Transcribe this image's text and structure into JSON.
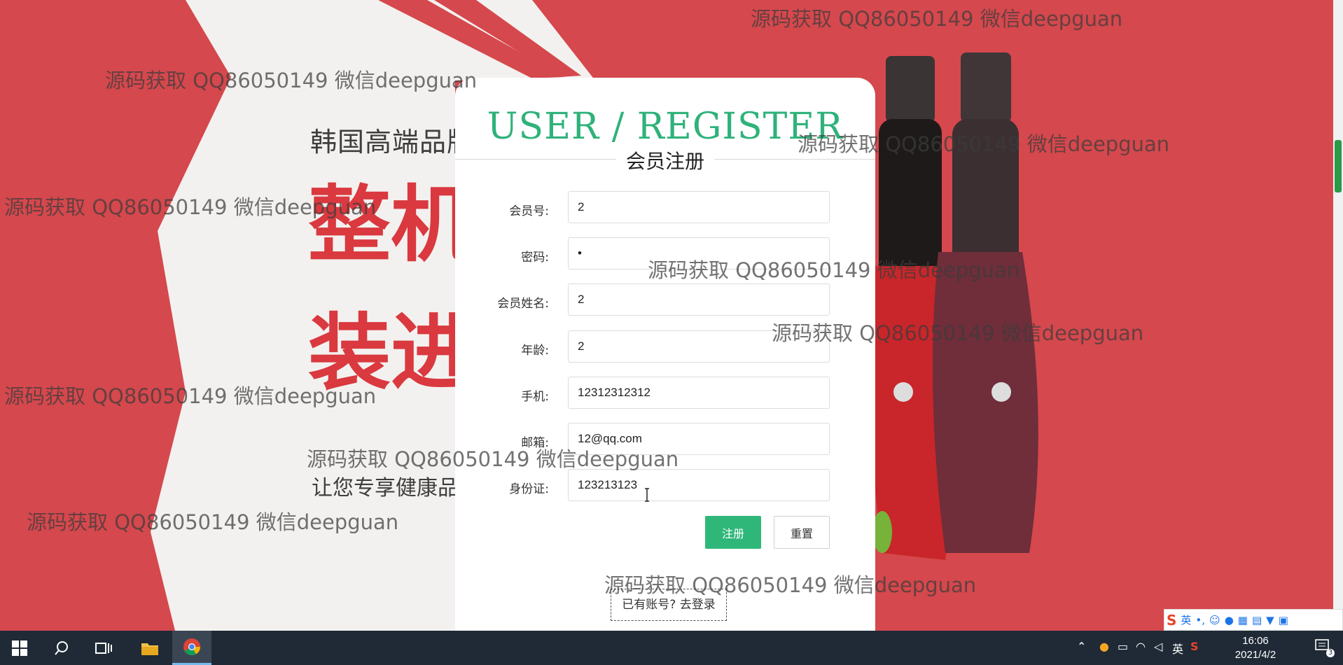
{
  "form": {
    "title": "USER / REGISTER",
    "subtitle": "会员注册",
    "fields": [
      {
        "label": "会员号:",
        "value": "2"
      },
      {
        "label": "密码:",
        "value": "•"
      },
      {
        "label": "会员姓名:",
        "value": "2"
      },
      {
        "label": "年龄:",
        "value": "2"
      },
      {
        "label": "手机:",
        "value": "12312312312"
      },
      {
        "label": "邮箱:",
        "value": "12@qq.com"
      },
      {
        "label": "身份证:",
        "value": "123213123"
      }
    ],
    "register_label": "注册",
    "reset_label": "重置",
    "login_link": "已有账号? 去登录"
  },
  "background": {
    "slogan_top": "韩国高端品牌",
    "slogan_line1": "整机原",
    "slogan_line2": "装进口",
    "slogan_sub": "让您专享健康品质生活",
    "brand_color": "#d5484d"
  },
  "watermark": "源码获取 QQ86050149 微信deepguan",
  "taskbar": {
    "time": "16:06",
    "date": "2021/4/2",
    "lang": "英",
    "notifications": "3"
  },
  "ime": {
    "lang": "英"
  },
  "colors": {
    "accent": "#2fb77a",
    "title": "#2fb27a"
  }
}
